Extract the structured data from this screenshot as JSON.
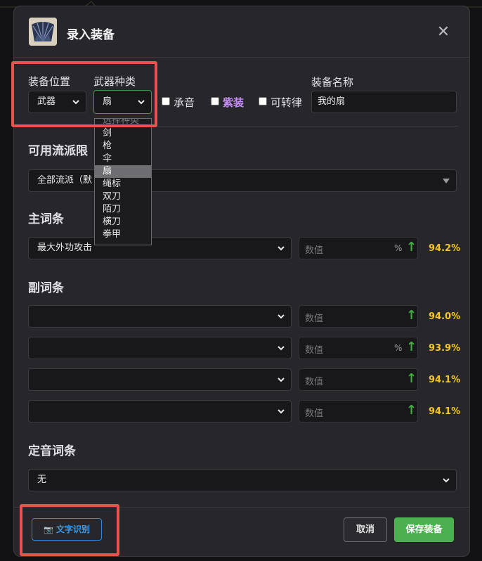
{
  "dialog": {
    "title": "录入装备",
    "close_label": "✕"
  },
  "form": {
    "slot_label": "装备位置",
    "slot_value": "武器",
    "weapon_type_label": "武器种类",
    "weapon_type_value": "扇",
    "chengyin_label": "承音",
    "purple_label": "紫装",
    "transferable_label": "可转律",
    "name_label": "装备名称",
    "name_value": "我的扇"
  },
  "weapon_type_dropdown": {
    "placeholder": "选择种类",
    "options": [
      "剑",
      "枪",
      "伞",
      "扇",
      "绳标",
      "双刀",
      "陌刀",
      "横刀",
      "拳甲"
    ],
    "selected": "扇"
  },
  "school": {
    "title": "可用流派限",
    "value": "全部流派（默"
  },
  "main_attr": {
    "title": "主词条",
    "attr": "最大外功攻击",
    "value_placeholder": "数值",
    "unit": "%",
    "arrow": "↑",
    "percent": "94.2%"
  },
  "sub_attrs": {
    "title": "副词条",
    "rows": [
      {
        "attr": "",
        "value_placeholder": "数值",
        "unit": "",
        "arrow": "↑",
        "percent": "94.0%"
      },
      {
        "attr": "",
        "value_placeholder": "数值",
        "unit": "%",
        "arrow": "↑",
        "percent": "93.9%"
      },
      {
        "attr": "",
        "value_placeholder": "数值",
        "unit": "",
        "arrow": "↑",
        "percent": "94.1%"
      },
      {
        "attr": "",
        "value_placeholder": "数值",
        "unit": "",
        "arrow": "↑",
        "percent": "94.1%"
      }
    ]
  },
  "fixed_attr": {
    "title": "定音词条",
    "value": "无"
  },
  "footer": {
    "ocr_icon": "📷",
    "ocr_label": "文字识别",
    "cancel_label": "取消",
    "save_label": "保存装备"
  },
  "colors": {
    "accent_green": "#4caf50",
    "percent_yellow": "#f3c623",
    "purple": "#c68df5",
    "ocr_blue": "#3a9cf0",
    "highlight_red": "#e9534f"
  }
}
